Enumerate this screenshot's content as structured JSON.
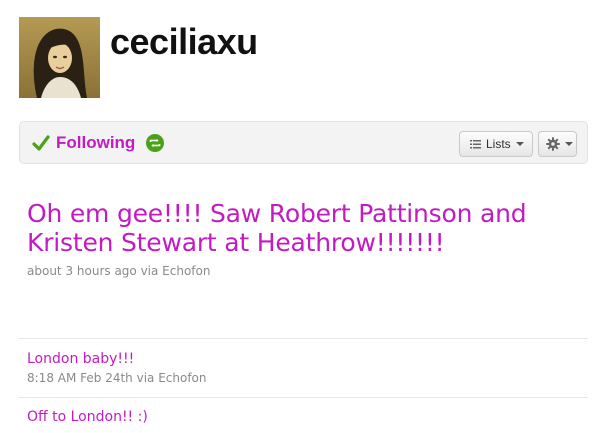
{
  "profile": {
    "username": "ceciliaxu"
  },
  "follow_bar": {
    "following_label": "Following",
    "lists_label": "Lists"
  },
  "tweets": [
    {
      "text": "Oh em gee!!!! Saw Robert Pattinson and Kristen Stewart at Heathrow!!!!!!!",
      "meta": "about 3 hours ago via Echofon"
    },
    {
      "text": "London baby!!!",
      "meta": "8:18 AM Feb 24th via Echofon"
    },
    {
      "text": "Off to London!! :)"
    }
  ],
  "icons": {
    "following": "check-icon",
    "notifications": "retweet-icon",
    "lists": "list-icon",
    "actions": "gear-icon"
  },
  "colors": {
    "link": "#c21bc2",
    "check": "#4ba21a",
    "meta": "#8a8a8a"
  }
}
